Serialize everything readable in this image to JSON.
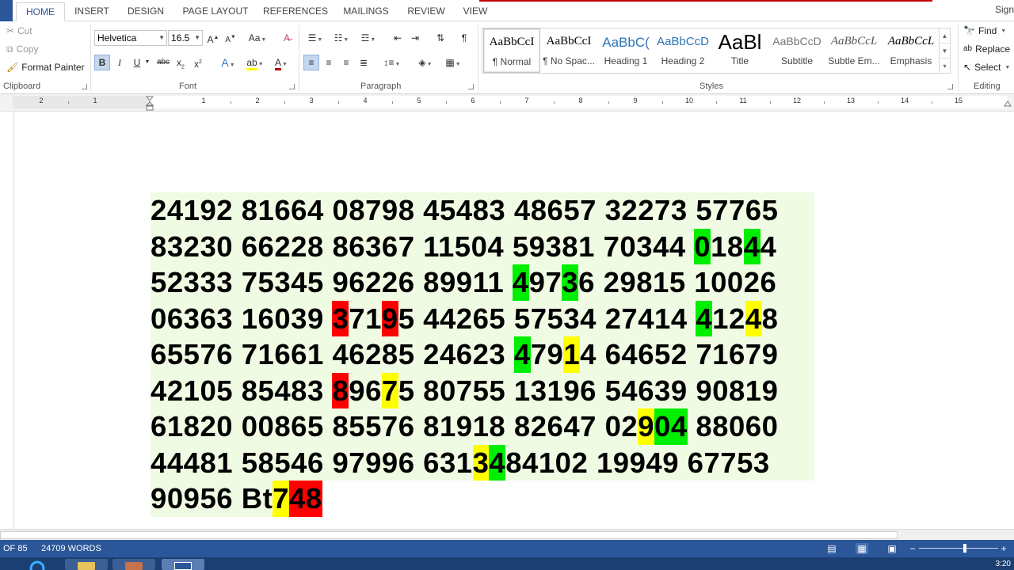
{
  "ribbon_tabs": [
    {
      "label": "HOME",
      "active": true
    },
    {
      "label": "INSERT"
    },
    {
      "label": "DESIGN"
    },
    {
      "label": "PAGE LAYOUT"
    },
    {
      "label": "REFERENCES"
    },
    {
      "label": "MAILINGS"
    },
    {
      "label": "REVIEW"
    },
    {
      "label": "VIEW"
    }
  ],
  "account": {
    "signin": "Sign"
  },
  "clipboard": {
    "label": "Clipboard",
    "cut": "Cut",
    "copy": "Copy",
    "format_painter": "Format Painter"
  },
  "font": {
    "label": "Font",
    "family": "Helvetica",
    "size": "16.5"
  },
  "paragraph": {
    "label": "Paragraph"
  },
  "styles": {
    "label": "Styles",
    "items": [
      {
        "sample": "AaBbCcI",
        "name": "¶ Normal"
      },
      {
        "sample": "AaBbCcI",
        "name": "¶ No Spac..."
      },
      {
        "sample": "AaBbC(",
        "name": "Heading 1"
      },
      {
        "sample": "AaBbCcD",
        "name": "Heading 2"
      },
      {
        "sample": "AaBl",
        "name": "Title"
      },
      {
        "sample": "AaBbCcD",
        "name": "Subtitle"
      },
      {
        "sample": "AaBbCcL",
        "name": "Subtle Em..."
      },
      {
        "sample": "AaBbCcL",
        "name": "Emphasis"
      }
    ]
  },
  "editing": {
    "label": "Editing",
    "find": "Find",
    "replace": "Replace",
    "select": "Select"
  },
  "ruler": {
    "labels": [
      "2",
      "1",
      "1",
      "2",
      "3",
      "4",
      "5",
      "6",
      "7",
      "8",
      "9",
      "10",
      "11",
      "12",
      "13",
      "14",
      "15"
    ]
  },
  "document": {
    "lines": [
      "24192 81664 08798 45483 48657 32273 57765",
      "83230 66228 86367 11504 59381 70344 01844",
      "52333 75345 96226 89911 49736 29815 10026",
      "06363 16039 37195 44265 57534 27414 41248",
      "65576 71661 46285 24623 47914 64652 71679",
      "42105 85483 89675 80755 13196 54639 90819",
      "61820 00865 85576 81918 82647 02904 88060",
      "44481 58546 97996 63134 84102 19949 67753",
      "90956 Bt748"
    ],
    "highlights": [
      {
        "line": 1,
        "char": 36,
        "color": "green"
      },
      {
        "line": 1,
        "char": 39,
        "color": "green"
      },
      {
        "line": 2,
        "char": 24,
        "color": "green"
      },
      {
        "line": 2,
        "char": 27,
        "color": "green"
      },
      {
        "line": 3,
        "char": 12,
        "color": "red"
      },
      {
        "line": 3,
        "char": 15,
        "color": "red"
      },
      {
        "line": 3,
        "char": 36,
        "color": "green"
      },
      {
        "line": 3,
        "char": 39,
        "color": "yellow"
      },
      {
        "line": 4,
        "char": 24,
        "color": "green"
      },
      {
        "line": 4,
        "char": 27,
        "color": "yellow"
      },
      {
        "line": 5,
        "char": 12,
        "color": "red"
      },
      {
        "line": 5,
        "char": 15,
        "color": "yellow"
      },
      {
        "line": 6,
        "char": 32,
        "color": "yellow"
      },
      {
        "line": 6,
        "char": 33,
        "color": "green"
      },
      {
        "line": 6,
        "char": 34,
        "color": "green"
      },
      {
        "line": 7,
        "char": 21,
        "color": "yellow"
      },
      {
        "line": 7,
        "char": 22,
        "color": "green"
      },
      {
        "line": 7,
        "char": 23,
        "color": "green"
      },
      {
        "line": 8,
        "char": 8,
        "color": "yellow"
      },
      {
        "line": 8,
        "char": 9,
        "color": "red"
      },
      {
        "line": 8,
        "char": 10,
        "color": "red"
      }
    ],
    "colors": {
      "green": "#00ee00",
      "yellow": "#ffff00",
      "red": "#ff0000",
      "line_background": "#f0fbe4"
    }
  },
  "status": {
    "page": "OF 85",
    "words": "24709 WORDS"
  },
  "taskbar": {
    "clock": "3:20"
  },
  "theme": {
    "accent": "#2b579a"
  }
}
